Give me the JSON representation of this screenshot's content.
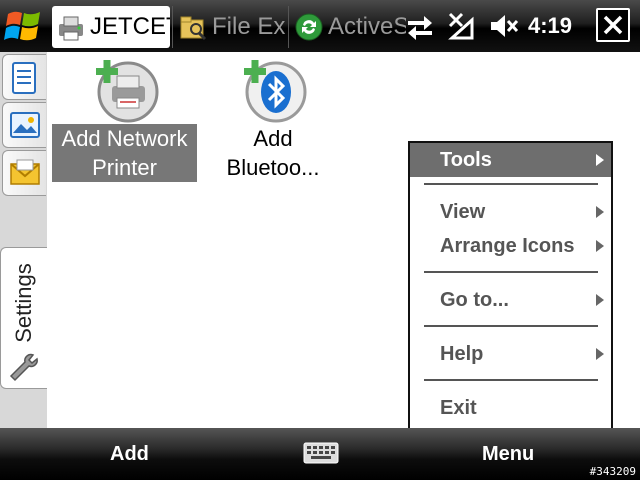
{
  "taskbar": {
    "tabs": [
      {
        "label": "JETCET",
        "active": true,
        "icon": "printer-app-icon"
      },
      {
        "label": "File Exp",
        "active": false,
        "icon": "file-explorer-icon"
      },
      {
        "label": "ActiveS",
        "active": false,
        "icon": "activesync-icon"
      }
    ],
    "status_icons": [
      "data-connection-icon",
      "no-signal-icon",
      "speaker-muted-icon"
    ],
    "clock": "4:19",
    "close_icon": "close-icon"
  },
  "rail": {
    "tabs": [
      "document-icon",
      "picture-icon",
      "mail-icon"
    ],
    "settings_label": "Settings",
    "settings_icon": "wrench-icon"
  },
  "items": [
    {
      "label_line1": "Add Network",
      "label_line2": "Printer",
      "icon": "add-network-printer-icon",
      "selected": true
    },
    {
      "label_line1": "Add",
      "label_line2": "Bluetoo...",
      "icon": "add-bluetooth-icon",
      "selected": false
    }
  ],
  "menu": {
    "items": [
      {
        "label": "Tools",
        "submenu": true,
        "selected": true
      },
      {
        "label": "View",
        "submenu": true
      },
      {
        "label": "Arrange Icons",
        "submenu": true
      },
      {
        "label": "Go to...",
        "submenu": true
      },
      {
        "label": "Help",
        "submenu": true
      },
      {
        "label": "Exit",
        "submenu": false
      }
    ]
  },
  "softkeys": {
    "left": "Add",
    "right": "Menu",
    "center_icon": "keyboard-icon"
  },
  "watermark": "#343209",
  "colors": {
    "selection": "#777777",
    "menu_selected": "#6e6e6e",
    "bluetooth_blue": "#1a6fd0",
    "plus_green": "#4caf50"
  }
}
